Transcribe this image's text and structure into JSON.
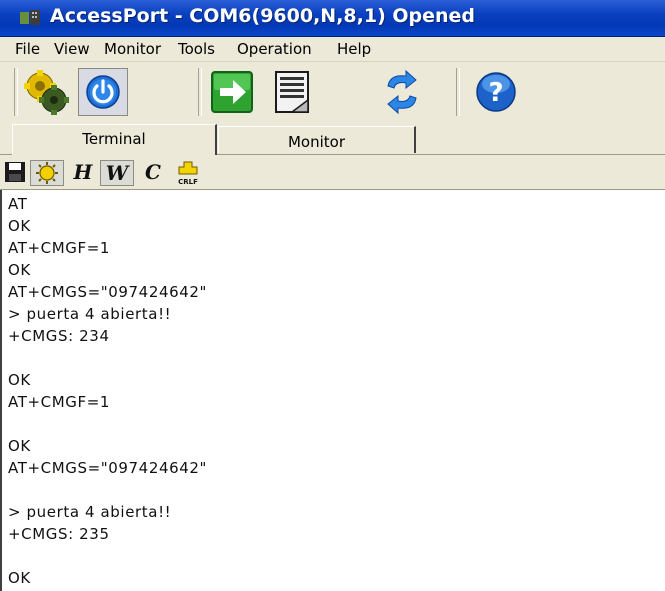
{
  "window": {
    "title": "AccessPort - COM6(9600,N,8,1) Opened"
  },
  "menu": {
    "items": [
      "File",
      "View",
      "Monitor",
      "Tools",
      "Operation",
      "Help"
    ]
  },
  "toolbar": {
    "buttons": [
      {
        "name": "settings-gears-icon"
      },
      {
        "name": "power-icon"
      },
      {
        "name": "open-port-arrow-icon"
      },
      {
        "name": "document-icon"
      },
      {
        "name": "refresh-arrows-icon"
      },
      {
        "name": "help-icon"
      }
    ]
  },
  "tabs": {
    "terminal": "Terminal",
    "monitor": "Monitor",
    "active": "Terminal"
  },
  "subtoolbar": {
    "h_label": "H",
    "w_label": "W",
    "c_label": "C",
    "crlf_label": "CRLF"
  },
  "terminal": {
    "lines": [
      "AT",
      "OK",
      "AT+CMGF=1",
      "OK",
      "AT+CMGS=\"097424642\"",
      "> puerta 4 abierta!!",
      "+CMGS: 234",
      "",
      "OK",
      "AT+CMGF=1",
      "",
      "OK",
      "AT+CMGS=\"097424642\"",
      "",
      "> puerta 4 abierta!!",
      "+CMGS: 235",
      "",
      "OK"
    ]
  },
  "colors": {
    "titlebar": "#0a3fbf",
    "chrome": "#ece9d8",
    "terminal_bg": "#ffffff"
  }
}
